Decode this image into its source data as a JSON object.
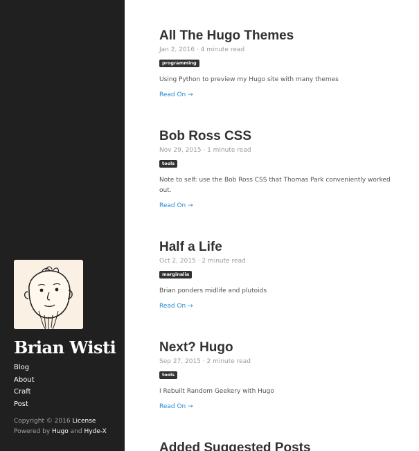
{
  "sidebar": {
    "site_title": "Brian Wisti",
    "nav": [
      "Blog",
      "About",
      "Craft",
      "Post"
    ],
    "copyright_prefix": "Copyright © 2016",
    "license_label": "License",
    "powered_by_prefix": "Powered by",
    "hugo_label": "Hugo",
    "and_label": "and",
    "theme_label": "Hyde-X"
  },
  "posts": [
    {
      "title": "All The Hugo Themes",
      "meta": "Jan 2, 2016 · 4 minute read",
      "tag": "programming",
      "summary": "Using Python to preview my Hugo site with many themes",
      "read_on": "Read On →"
    },
    {
      "title": "Bob Ross CSS",
      "meta": "Nov 29, 2015 · 1 minute read",
      "tag": "tools",
      "summary": "Note to self: use the Bob Ross CSS that Thomas Park conveniently worked out.",
      "read_on": "Read On →"
    },
    {
      "title": "Half a Life",
      "meta": "Oct 2, 2015 · 2 minute read",
      "tag": "marginalia",
      "summary": "Brian ponders midlife and plutoids",
      "read_on": "Read On →"
    },
    {
      "title": "Next? Hugo",
      "meta": "Sep 27, 2015 · 2 minute read",
      "tag": "tools",
      "summary": "I Rebuilt Random Geekery with Hugo",
      "read_on": "Read On →"
    },
    {
      "title": "Added Suggested Posts"
    }
  ],
  "colors": {
    "sidebar_bg": "#202020",
    "link": "#268bd2",
    "tag_bg": "#313131"
  }
}
